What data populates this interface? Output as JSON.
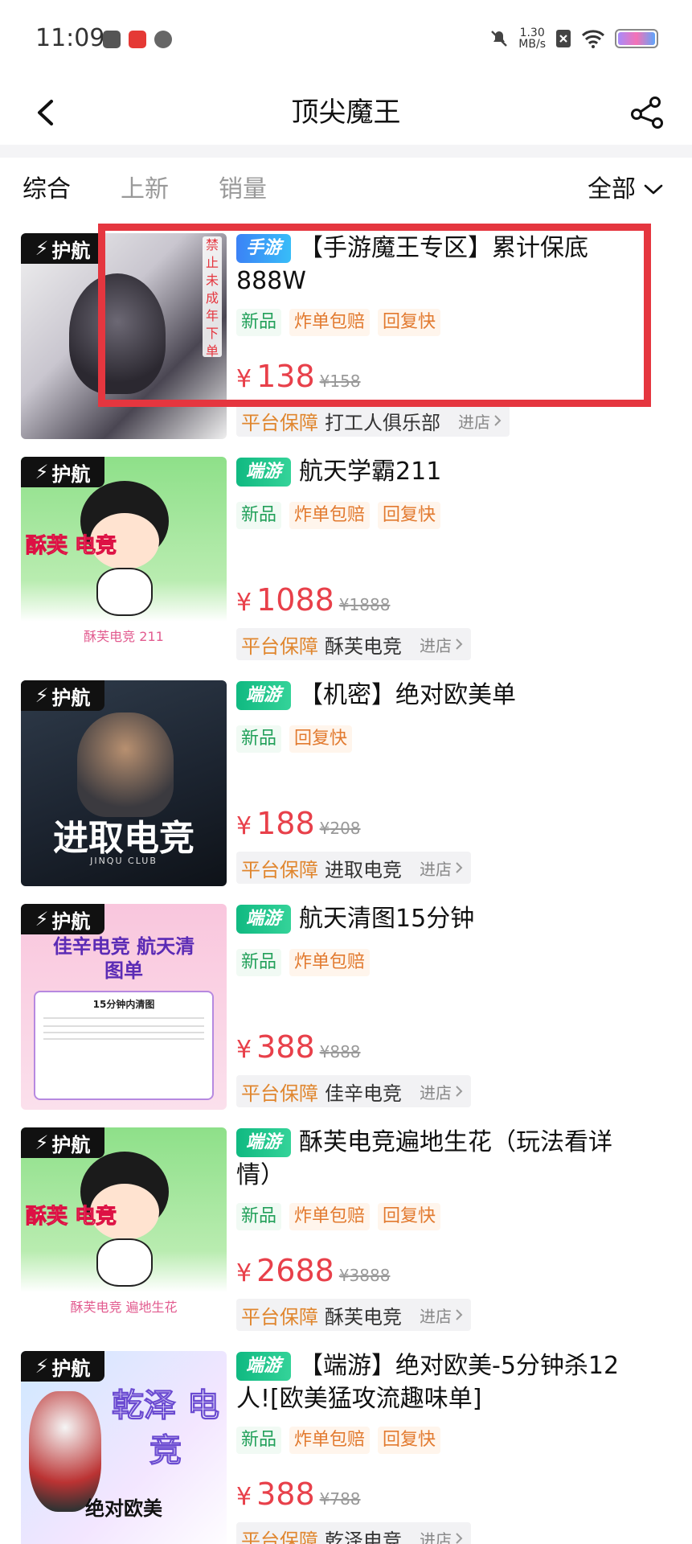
{
  "status_bar": {
    "time": "11:09",
    "net_speed_value": "1.30",
    "net_speed_unit": "MB/s",
    "left_icons": [
      "notification-app-icon",
      "red-app-icon",
      "gear-app-icon"
    ],
    "right_icons": [
      "mute-icon",
      "speed-icon",
      "sim-off-icon",
      "wifi-icon",
      "battery-icon"
    ]
  },
  "nav": {
    "title": "顶尖魔王",
    "back_icon": "chevron-left-icon",
    "share_icon": "share-icon"
  },
  "filters": {
    "tabs": [
      "综合",
      "上新",
      "销量"
    ],
    "active_tab": "综合",
    "all_label": "全部"
  },
  "common": {
    "badge_label": "护航",
    "guarantee_label": "平台保障",
    "enter_shop_label": "进店",
    "currency": "¥",
    "orig_currency": "¥"
  },
  "items": [
    {
      "game_tag": "手游",
      "title": "【手游魔王专区】累计保底888W",
      "tags": [
        "新品",
        "炸单包赔",
        "回复快"
      ],
      "price": "138",
      "orig_price": "158",
      "shop": "打工人俱乐部",
      "thumb_text": "禁止未成年下单",
      "thumb_caption": ""
    },
    {
      "game_tag": "端游",
      "title": "航天学霸211",
      "tags": [
        "新品",
        "炸单包赔",
        "回复快"
      ],
      "price": "1088",
      "orig_price": "1888",
      "shop": "酥芙电竞",
      "thumb_text": "酥芙 电竞",
      "thumb_caption": "酥芙电竞 211"
    },
    {
      "game_tag": "端游",
      "title": "【机密】绝对欧美单",
      "tags": [
        "新品",
        "回复快"
      ],
      "price": "188",
      "orig_price": "208",
      "shop": "进取电竞",
      "thumb_text": "进取电竞",
      "thumb_caption": "JINQU CLUB"
    },
    {
      "game_tag": "端游",
      "title": "航天清图15分钟",
      "tags": [
        "新品",
        "炸单包赔"
      ],
      "price": "388",
      "orig_price": "888",
      "shop": "佳辛电竞",
      "thumb_text": "佳辛电竞 航天清图单",
      "thumb_caption": "15分钟内清图"
    },
    {
      "game_tag": "端游",
      "title": "酥芙电竞遍地生花（玩法看详情）",
      "tags": [
        "新品",
        "炸单包赔",
        "回复快"
      ],
      "price": "2688",
      "orig_price": "3888",
      "shop": "酥芙电竞",
      "thumb_text": "酥芙 电竞",
      "thumb_caption": "酥芙电竞 遍地生花"
    },
    {
      "game_tag": "端游",
      "title": "【端游】绝对欧美-5分钟杀12人![欧美猛攻流趣味单]",
      "tags": [
        "新品",
        "炸单包赔",
        "回复快"
      ],
      "price": "388",
      "orig_price": "788",
      "shop": "乾泽电竞",
      "thumb_text": "乾泽 电竞",
      "thumb_caption": "绝对欧美"
    }
  ],
  "colors": {
    "price": "#e8404a",
    "guarantee": "#e0862e",
    "new_tag": "#22a05a",
    "warm_tag": "#e27a2f",
    "highlight": "#e5363f",
    "mobile_tag": "#3b82f6",
    "pc_tag": "#10b981"
  }
}
